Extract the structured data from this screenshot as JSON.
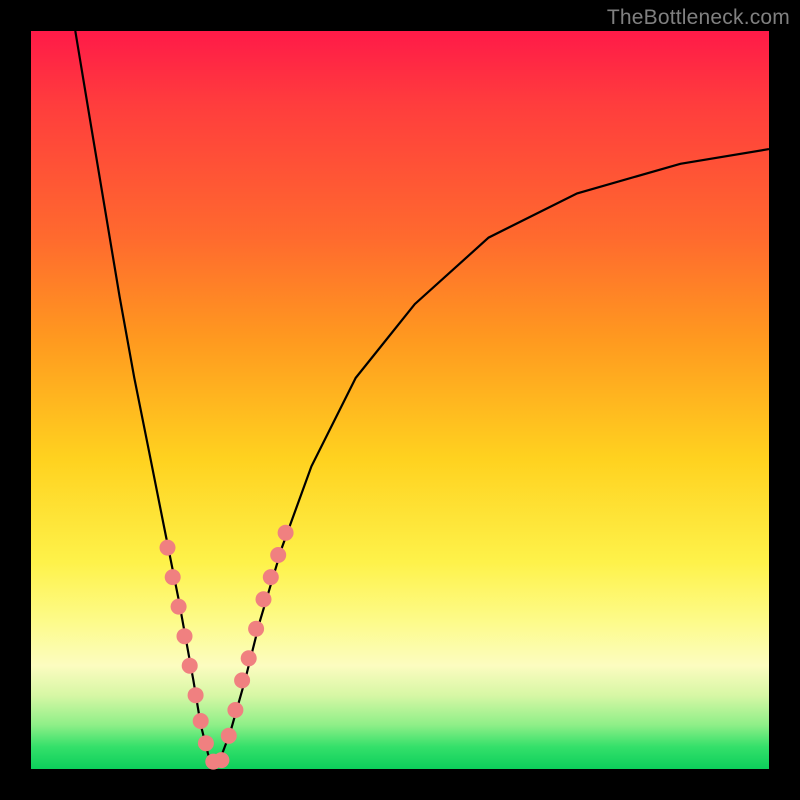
{
  "watermark": "TheBottleneck.com",
  "chart_data": {
    "type": "line",
    "title": "",
    "xlabel": "",
    "ylabel": "",
    "xlim": [
      0,
      100
    ],
    "ylim": [
      0,
      100
    ],
    "gradient_stops": [
      {
        "pos": 0,
        "color": "#ff1a48"
      },
      {
        "pos": 10,
        "color": "#ff3d3d"
      },
      {
        "pos": 28,
        "color": "#ff6a2e"
      },
      {
        "pos": 42,
        "color": "#ff9a1f"
      },
      {
        "pos": 58,
        "color": "#ffd21f"
      },
      {
        "pos": 72,
        "color": "#fef24a"
      },
      {
        "pos": 80,
        "color": "#fdfb8a"
      },
      {
        "pos": 86,
        "color": "#fcfcc0"
      },
      {
        "pos": 90,
        "color": "#d7f7a5"
      },
      {
        "pos": 94,
        "color": "#8fef88"
      },
      {
        "pos": 97,
        "color": "#34e06a"
      },
      {
        "pos": 100,
        "color": "#0ccf5b"
      }
    ],
    "series": [
      {
        "name": "bottleneck-curve",
        "x": [
          6,
          8,
          10,
          12,
          14,
          16,
          18,
          20,
          22,
          23,
          24,
          24.7,
          25.5,
          27,
          29,
          31,
          34,
          38,
          44,
          52,
          62,
          74,
          88,
          100
        ],
        "y": [
          100,
          88,
          76,
          64,
          53,
          43,
          33,
          23,
          12,
          6,
          2,
          0,
          1,
          5,
          12,
          20,
          30,
          41,
          53,
          63,
          72,
          78,
          82,
          84
        ]
      }
    ],
    "markers": {
      "name": "highlight-points",
      "color": "#f08080",
      "points": [
        {
          "x": 18.5,
          "y": 30
        },
        {
          "x": 19.2,
          "y": 26
        },
        {
          "x": 20.0,
          "y": 22
        },
        {
          "x": 20.8,
          "y": 18
        },
        {
          "x": 21.5,
          "y": 14
        },
        {
          "x": 22.3,
          "y": 10
        },
        {
          "x": 23.0,
          "y": 6.5
        },
        {
          "x": 23.7,
          "y": 3.5
        },
        {
          "x": 24.7,
          "y": 1.0
        },
        {
          "x": 25.8,
          "y": 1.2
        },
        {
          "x": 26.8,
          "y": 4.5
        },
        {
          "x": 27.7,
          "y": 8
        },
        {
          "x": 28.6,
          "y": 12
        },
        {
          "x": 29.5,
          "y": 15
        },
        {
          "x": 30.5,
          "y": 19
        },
        {
          "x": 31.5,
          "y": 23
        },
        {
          "x": 32.5,
          "y": 26
        },
        {
          "x": 33.5,
          "y": 29
        },
        {
          "x": 34.5,
          "y": 32
        }
      ]
    }
  }
}
